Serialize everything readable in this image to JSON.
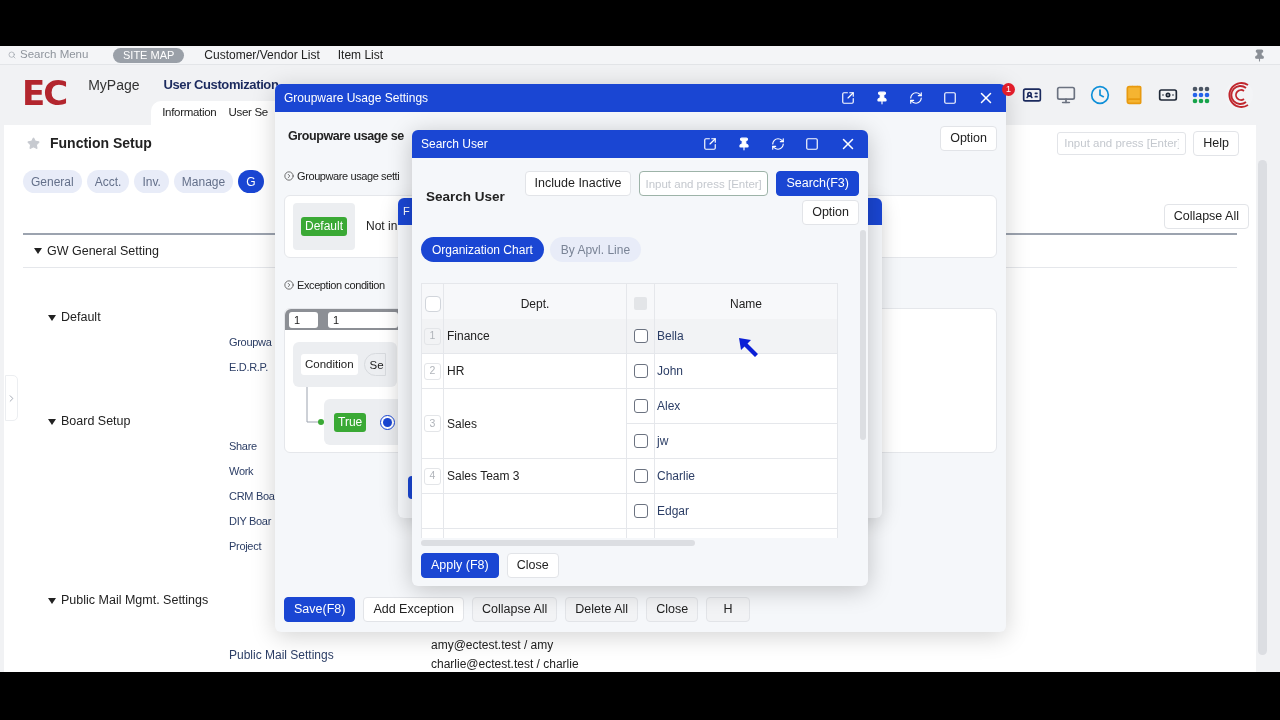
{
  "top_bar": {
    "search_placeholder": "Search Menu",
    "site_map": "SITE MAP",
    "links": [
      "Customer/Vendor List",
      "Item List"
    ]
  },
  "header": {
    "logo": "EC",
    "nav": [
      {
        "label": "MyPage",
        "selected": false
      },
      {
        "label": "User Customization",
        "selected": true
      }
    ],
    "subtabs": [
      "Information",
      "User Se"
    ],
    "notification_count": "1"
  },
  "function_setup": {
    "title": "Function Setup",
    "search_placeholder": "Input and press [Enter]",
    "help": "Help",
    "collapse_all": "Collapse All",
    "tabs": [
      {
        "label": "General",
        "selected": false
      },
      {
        "label": "Acct.",
        "selected": false
      },
      {
        "label": "Inv.",
        "selected": false
      },
      {
        "label": "Manage",
        "selected": false
      },
      {
        "label": "G",
        "selected": true
      }
    ],
    "tree": [
      {
        "label": "GW General Setting",
        "expanded": true,
        "children": [
          {
            "label": "Default",
            "expanded": true,
            "children": [
              {
                "label": "Groupwa"
              },
              {
                "label": "E.D.R.P."
              }
            ]
          },
          {
            "label": "Board Setup",
            "expanded": true,
            "children": [
              {
                "label": "Share"
              },
              {
                "label": "Work"
              },
              {
                "label": "CRM Boa"
              },
              {
                "label": "DIY Boar"
              },
              {
                "label": "Project"
              }
            ]
          },
          {
            "label": "Public Mail Mgmt. Settings",
            "expanded": true,
            "children": [
              {
                "label": "Public Mail Settings",
                "values": [
                  "amy@ectest.test / amy",
                  "charlie@ectest.test / charlie"
                ]
              }
            ]
          }
        ]
      }
    ]
  },
  "groupware_dialog": {
    "title": "Groupware Usage Settings",
    "heading": "Groupware usage se",
    "option": "Option",
    "usage_section": "Groupware usage setti",
    "default_badge": "Default",
    "usage_value": "Not in",
    "exception_section": "Exception condition",
    "range": [
      "1",
      "1"
    ],
    "condition": "Condition",
    "condition_field": "Se",
    "true_badge": "True",
    "radio_selected": true,
    "buttons": [
      {
        "label": "Save(F8)",
        "kind": "primary"
      },
      {
        "label": "Add Exception",
        "kind": "default"
      },
      {
        "label": "Collapse All",
        "kind": "muted"
      },
      {
        "label": "Delete All",
        "kind": "muted"
      },
      {
        "label": "Close",
        "kind": "muted"
      },
      {
        "label": "H",
        "kind": "muted"
      }
    ]
  },
  "behind_dialog": {
    "title": "F"
  },
  "search_dialog": {
    "title": "Search User",
    "heading": "Search User",
    "include_inactive": "Include Inactive",
    "search_placeholder": "Input and press [Enter]",
    "search_button": "Search(F3)",
    "option": "Option",
    "tabs": [
      {
        "label": "Organization Chart",
        "selected": true
      },
      {
        "label": "By Apvl. Line",
        "selected": false
      }
    ],
    "columns": [
      "Dept.",
      "Name"
    ],
    "header_checks": [
      {
        "checked": false,
        "disabled": false
      },
      {
        "checked": false,
        "disabled": true
      }
    ],
    "groups": [
      {
        "number": "1",
        "dept": "Finance",
        "highlighted": true,
        "users": [
          {
            "name": "Bella",
            "checked": false
          }
        ]
      },
      {
        "number": "2",
        "dept": "HR",
        "highlighted": false,
        "users": [
          {
            "name": "John",
            "checked": false
          }
        ]
      },
      {
        "number": "3",
        "dept": "Sales",
        "highlighted": false,
        "users": [
          {
            "name": "Alex",
            "checked": false
          },
          {
            "name": "jw",
            "checked": false
          }
        ]
      },
      {
        "number": "4",
        "dept": "Sales Team 3",
        "highlighted": false,
        "users": [
          {
            "name": "Charlie",
            "checked": false
          }
        ]
      },
      {
        "highlighted": false,
        "users": [
          {
            "name": "Edgar",
            "checked": false
          }
        ]
      }
    ],
    "buttons": [
      {
        "label": "Apply (F8)",
        "kind": "primary"
      },
      {
        "label": "Close",
        "kind": "default"
      }
    ]
  }
}
